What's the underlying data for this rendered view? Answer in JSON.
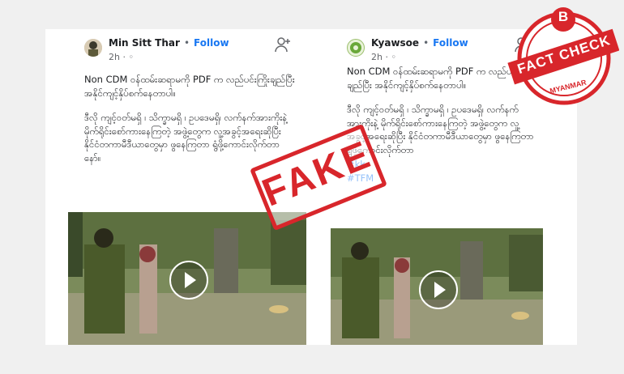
{
  "posts": [
    {
      "user": "Min Sitt Thar",
      "follow": "Follow",
      "time": "2h",
      "paragraph1": "Non CDM ဝန်ထမ်းဆရာမကို PDF က လည်ပင်းကြိုးချည်ပြီး အနိုင်ကျင့်နှိပ်စက်နေတာပါ။",
      "paragraph2": "ဒီလို ကျင့်ဝတ်မရှိ ၊ သိက္ခာမရှိ ၊ ဥပဒေမရှိ၊ လက်နက်အားကိုးနဲ့ မိုက်ရိုင်းစော်ကားနေကြတဲ့ အဖွဲ့တွေက လူ့အခွင့်အရေးဆိုပြီး နိုင်ငံတကာမီဒီယာတွေမှာ ဖွနေကြတာ ရွံဖို့ကောင်းလိုက်တာနော်။"
    },
    {
      "user": "Kyawsoe",
      "follow": "Follow",
      "time": "2h",
      "paragraph1": "Non CDM ဝန်ထမ်းဆရာမကို PDF က လည်ပင်းကြိုးချည်ပြီး အနိုင်ကျင့်နှိပ်စက်နေတာပါ။",
      "paragraph2": "ဒီလို ကျင့်ဝတ်မရှိ ၊ သိက္ခာမရှိ ၊ ဥပဒေမရှိ၊ လက်နက်အားကိုးနဲ့ မိုက်ရိုင်းစော်ကားနေကြတဲ့ အဖွဲ့တွေက လူ့အခွင့်အရေးဆိုပြီး နိုင်ငံတကာမီဒီယာတွေမှာ ဖွနေကြတာ ရွံဖို့ကောင်းလိုက်တာ",
      "hashtag1": "#kk",
      "hashtag2": "#TFM"
    }
  ],
  "stamp": "FAKE",
  "badge": {
    "letter": "B",
    "top": "FACT CHECK",
    "bottom": "MYANMAR"
  },
  "icons": [
    "user-add-icon",
    "play-icon"
  ],
  "colors": {
    "link": "#1877f2",
    "stamp": "#d8262b"
  }
}
